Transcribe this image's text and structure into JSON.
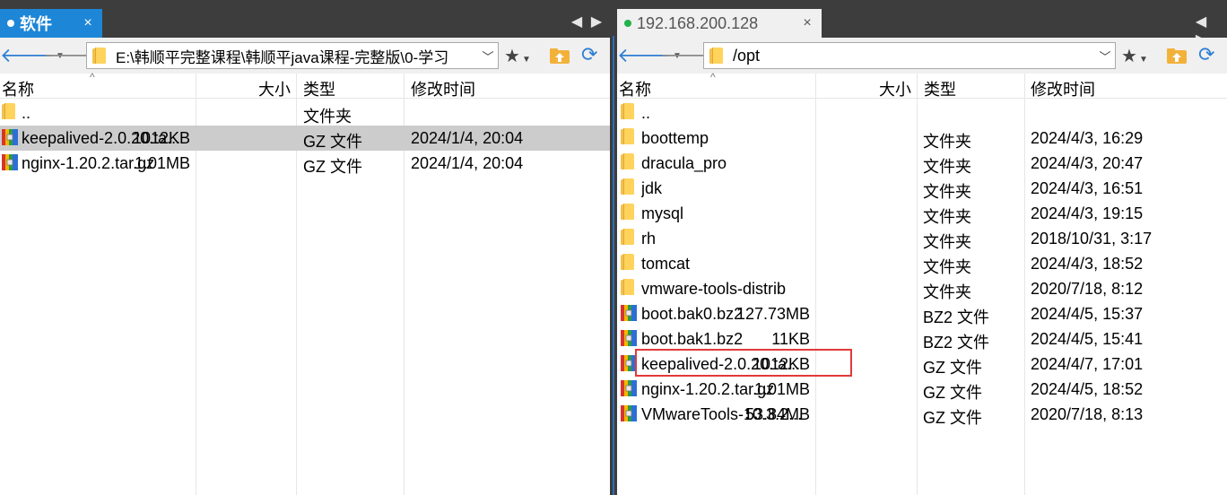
{
  "left": {
    "tab": {
      "title": "软件",
      "close": "×"
    },
    "nav": {
      "prev": "◀",
      "next": "▶"
    },
    "path": "E:\\韩顺平完整课程\\韩顺平java课程-完整版\\0-学习",
    "columns": {
      "name": "名称",
      "size": "大小",
      "type": "类型",
      "modified": "修改时间"
    },
    "rows": [
      {
        "icon": "folder",
        "name": "..",
        "size": "",
        "type": "文件夹",
        "modified": ""
      },
      {
        "icon": "archive",
        "name": "keepalived-2.0.20.ta...",
        "size": "1012KB",
        "type": "GZ 文件",
        "modified": "2024/1/4, 20:04",
        "selected": true
      },
      {
        "icon": "archive",
        "name": "nginx-1.20.2.tar.gz",
        "size": "1.01MB",
        "type": "GZ 文件",
        "modified": "2024/1/4, 20:04"
      }
    ]
  },
  "right": {
    "tab": {
      "title": "192.168.200.128",
      "close": "×"
    },
    "nav": {
      "prev": "◀",
      "next": "▶"
    },
    "path": "/opt",
    "columns": {
      "name": "名称",
      "size": "大小",
      "type": "类型",
      "modified": "修改时间"
    },
    "rows": [
      {
        "icon": "folder",
        "name": "..",
        "size": "",
        "type": "",
        "modified": ""
      },
      {
        "icon": "folder",
        "name": "boottemp",
        "size": "",
        "type": "文件夹",
        "modified": "2024/4/3, 16:29"
      },
      {
        "icon": "folder",
        "name": "dracula_pro",
        "size": "",
        "type": "文件夹",
        "modified": "2024/4/3, 20:47"
      },
      {
        "icon": "folder",
        "name": "jdk",
        "size": "",
        "type": "文件夹",
        "modified": "2024/4/3, 16:51"
      },
      {
        "icon": "folder",
        "name": "mysql",
        "size": "",
        "type": "文件夹",
        "modified": "2024/4/3, 19:15"
      },
      {
        "icon": "folder",
        "name": "rh",
        "size": "",
        "type": "文件夹",
        "modified": "2018/10/31, 3:17"
      },
      {
        "icon": "folder",
        "name": "tomcat",
        "size": "",
        "type": "文件夹",
        "modified": "2024/4/3, 18:52"
      },
      {
        "icon": "folder",
        "name": "vmware-tools-distrib",
        "size": "",
        "type": "文件夹",
        "modified": "2020/7/18, 8:12"
      },
      {
        "icon": "archive",
        "name": "boot.bak0.bz2",
        "size": "127.73MB",
        "type": "BZ2 文件",
        "modified": "2024/4/5, 15:37"
      },
      {
        "icon": "archive",
        "name": "boot.bak1.bz2",
        "size": "11KB",
        "type": "BZ2 文件",
        "modified": "2024/4/5, 15:41"
      },
      {
        "icon": "archive",
        "name": "keepalived-2.0.20.ta...",
        "size": "1012KB",
        "type": "GZ 文件",
        "modified": "2024/4/7, 17:01",
        "highlighted": true
      },
      {
        "icon": "archive",
        "name": "nginx-1.20.2.tar.gz",
        "size": "1.01MB",
        "type": "GZ 文件",
        "modified": "2024/4/5, 18:52"
      },
      {
        "icon": "archive",
        "name": "VMwareTools-10.3.2...",
        "size": "53.84MB",
        "type": "GZ 文件",
        "modified": "2020/7/18, 8:13"
      }
    ]
  },
  "icons": {
    "back": "arrow-left-icon",
    "forward": "arrow-right-icon",
    "favorites": "star-icon",
    "up": "folder-up-icon",
    "refresh": "refresh-icon",
    "folder": "folder-icon",
    "archive": "archive-icon"
  },
  "colors": {
    "active_tab": "#1e86d6",
    "selected_row": "#cccccc",
    "highlight_box": "#e03a3a",
    "connected_dot": "#22b14c"
  }
}
